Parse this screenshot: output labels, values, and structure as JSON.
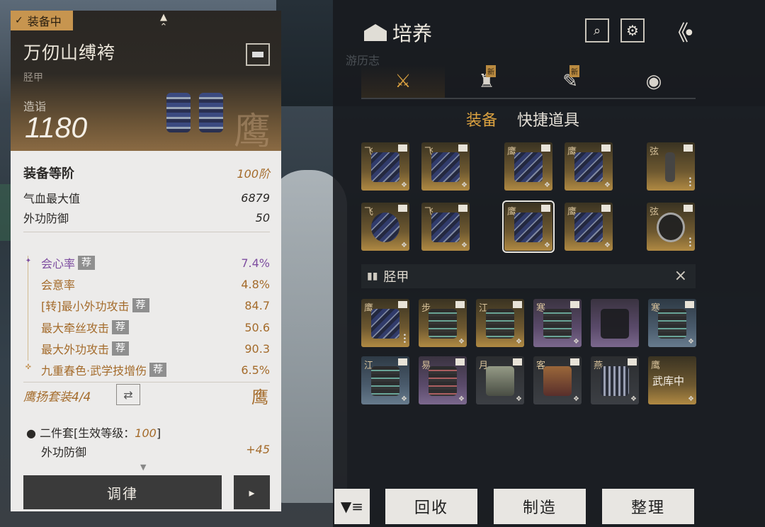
{
  "item": {
    "status_tag": "装备中",
    "name": "万仞山缚袴",
    "slot_type": "胫甲",
    "score_label": "造诣",
    "score": "1180",
    "set_seal": "鹰"
  },
  "stats": {
    "tier_label": "装备等阶",
    "tier_value": "100阶",
    "hp_label": "气血最大值",
    "hp_value": "6879",
    "def_label": "外功防御",
    "def_value": "50"
  },
  "sub_stats": [
    {
      "label": "会心率",
      "rec": "荐",
      "value": "7.4%"
    },
    {
      "label": "会意率",
      "rec": "",
      "value": "4.8%"
    },
    {
      "label": "[转]最小外功攻击",
      "rec": "荐",
      "value": "84.7"
    },
    {
      "label": "最大牵丝攻击",
      "rec": "荐",
      "value": "50.6"
    },
    {
      "label": "最大外功攻击",
      "rec": "荐",
      "value": "90.3"
    },
    {
      "label": "九重春色·武学技增伤",
      "rec": "荐",
      "value": "6.5%"
    }
  ],
  "set_info": {
    "name": "鹰扬套装4/4",
    "seal": "鹰",
    "two_piece_prefix": "二件套[生效等级：",
    "two_piece_level": "100",
    "two_piece_suffix": "]",
    "bonus_label": "外功防御",
    "bonus_value": "+45"
  },
  "left_buttons": {
    "tune": "调律",
    "more": "▸"
  },
  "panel": {
    "title": "培养",
    "ghost_text": "游历志",
    "new_badge": "新",
    "sub_tabs": [
      "装备",
      "快捷道具"
    ],
    "shin_bar_label": "胫甲",
    "close": "×"
  },
  "equipped_slots": [
    {
      "char": "飞"
    },
    {
      "char": "飞"
    },
    {
      "char": "鹰"
    },
    {
      "char": "鹰"
    },
    {
      "char": "弦"
    },
    {
      "char": "飞"
    },
    {
      "char": "飞"
    },
    {
      "char": "鹰"
    },
    {
      "char": "鹰"
    },
    {
      "char": "弦"
    }
  ],
  "inventory": [
    {
      "char": "鹰"
    },
    {
      "char": "步"
    },
    {
      "char": "江"
    },
    {
      "char": "寒"
    },
    {
      "char": ""
    },
    {
      "char": "寒"
    },
    {
      "char": "江"
    },
    {
      "char": "易"
    },
    {
      "char": "月"
    },
    {
      "char": "客"
    },
    {
      "char": "燕"
    },
    {
      "char": "鹰",
      "store": "武库中"
    }
  ],
  "bottom_buttons": {
    "recycle": "回收",
    "craft": "制造",
    "sort": "整理"
  },
  "colors": {
    "accent": "#d9a040",
    "gold_text": "#a46b2b",
    "purple_text": "#7e4ea0"
  }
}
